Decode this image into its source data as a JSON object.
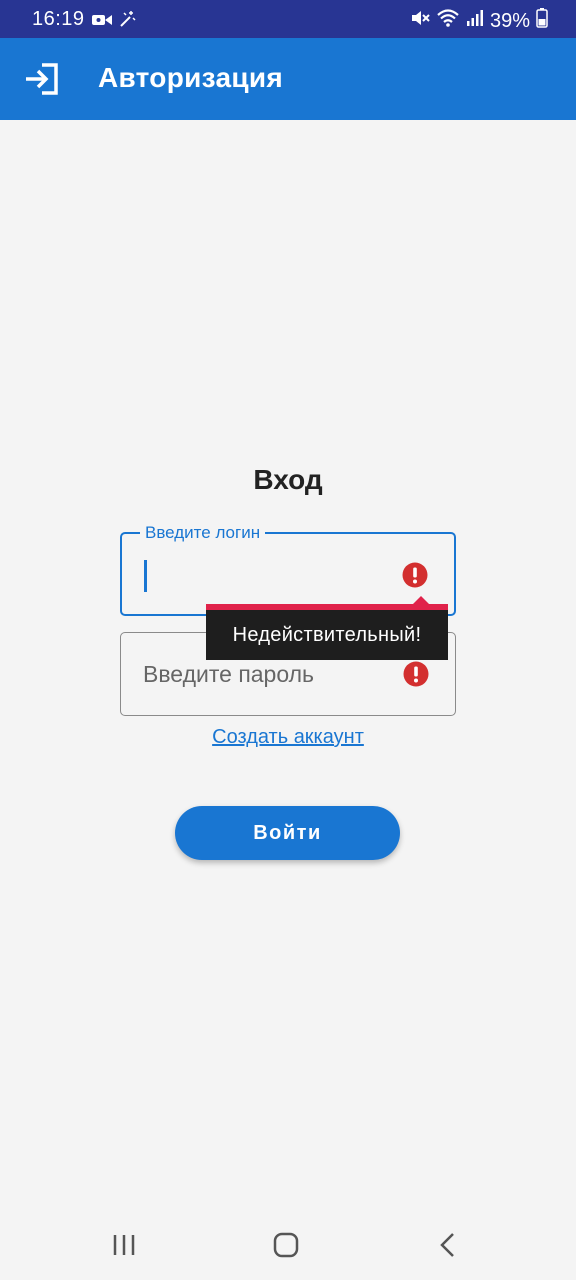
{
  "status_bar": {
    "time": "16:19",
    "battery": "39%",
    "icons": [
      "video-camera-icon",
      "magic-wand-icon",
      "mute-icon",
      "wifi-icon",
      "signal-icon",
      "battery-icon"
    ]
  },
  "app_bar": {
    "icon": "login-icon",
    "title": "Авторизация",
    "color": "#1976d2"
  },
  "form": {
    "heading": "Вход",
    "login_field": {
      "label": "Введите логин",
      "value": "",
      "error_icon": "error-icon"
    },
    "password_field": {
      "placeholder": "Введите пароль",
      "value": "",
      "error_icon": "error-icon"
    },
    "error_popup": {
      "text": "Недействительный!",
      "accent_color": "#e0224a"
    },
    "create_account_link": "Создать аккаунт",
    "submit_button": "Войти"
  },
  "nav_bar": {
    "buttons": [
      "recents-icon",
      "home-icon",
      "back-icon"
    ]
  }
}
